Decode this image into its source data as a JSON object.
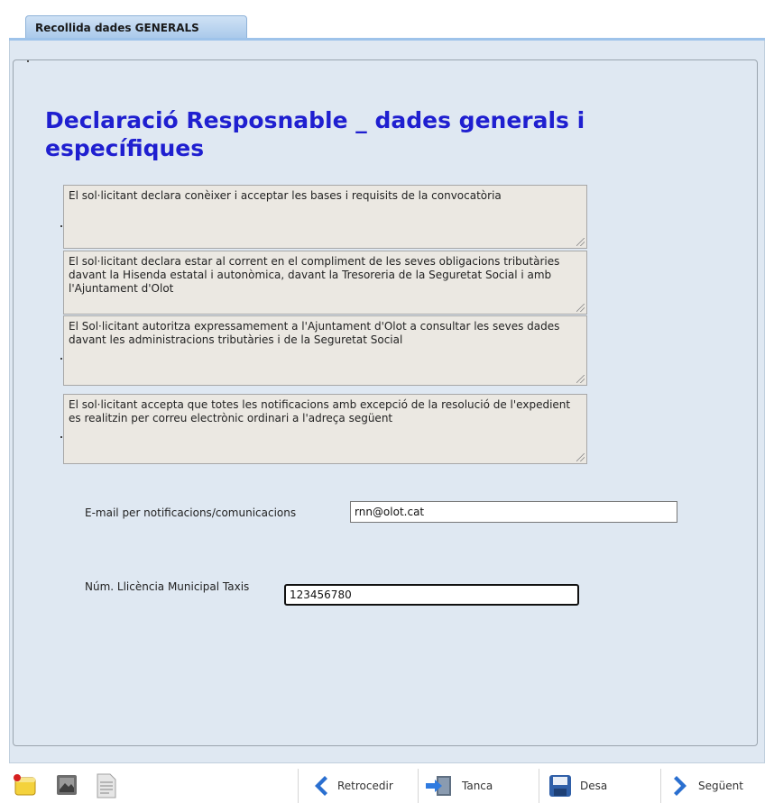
{
  "tab": {
    "label": "Recollida dades GENERALS"
  },
  "form": {
    "title": "Declaració Resposnable _ dades generals i específiques",
    "declarations": [
      "El sol·licitant declara conèixer i acceptar les bases i requisits de la convocatòria",
      "El sol·licitant declara estar al corrent en el compliment de les seves obligacions tributàries davant la Hisenda estatal i autonòmica, davant la Tresoreria de la Seguretat Social i amb l'Ajuntament d'Olot",
      "El Sol·licitant  autoritza expressamement a l'Ajuntament d'Olot a consultar les seves dades davant les administracions tributàries i de la Seguretat Social",
      "El sol·licitant accepta que totes les notificacions amb excepció de la resolució de l'expedient es realitzin per correu electrònic ordinari a l'adreça següent"
    ],
    "email": {
      "label": "E-mail per notificacions/comunicacions",
      "value": "rnn@olot.cat"
    },
    "license": {
      "label": "Núm. Llicència Municipal Taxis",
      "value": "123456780"
    }
  },
  "toolbar": {
    "back_label": "Retrocedir",
    "close_label": "Tanca",
    "save_label": "Desa",
    "next_label": "Següent"
  }
}
